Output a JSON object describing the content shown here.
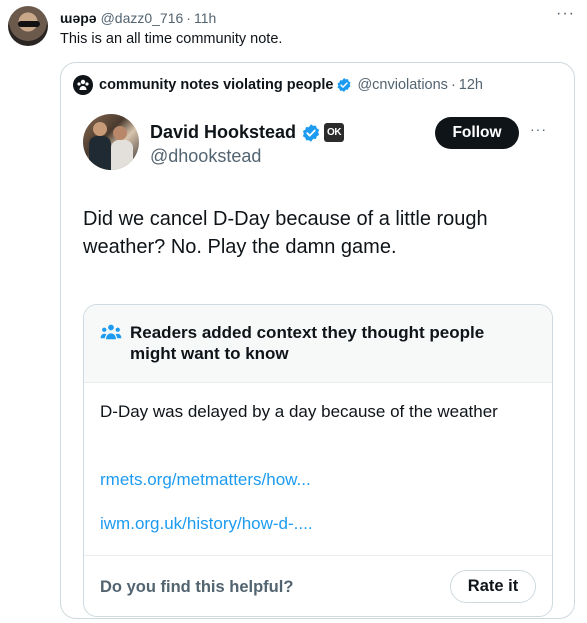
{
  "outer_post": {
    "display_name": "ɯǝpǝ",
    "handle": "@dazz0_716",
    "time": "11h",
    "text": "This is an all time community note.",
    "more_icon": "more-horizontal-icon"
  },
  "quoted_post": {
    "display_name": "community notes violating people",
    "handle": "@cnviolations",
    "time": "12h",
    "verified": true
  },
  "embedded_post": {
    "display_name": "David Hookstead",
    "badge_text": "OK",
    "handle": "@dhookstead",
    "follow_label": "Follow",
    "body": "Did we cancel D-Day because of a little rough weather? No. Play the damn game."
  },
  "community_note": {
    "title": "Readers added context they thought people might want to know",
    "text": "D-Day was delayed by a day because of the weather",
    "links": [
      "rmets.org/metmatters/how...",
      "iwm.org.uk/history/how-d-...."
    ],
    "helpful_question": "Do you find this helpful?",
    "rate_label": "Rate it"
  },
  "colors": {
    "text_primary": "#0f1419",
    "text_secondary": "#536471",
    "link": "#1d9bf0",
    "verified": "#1d9bf0",
    "border": "#cfd9de"
  }
}
